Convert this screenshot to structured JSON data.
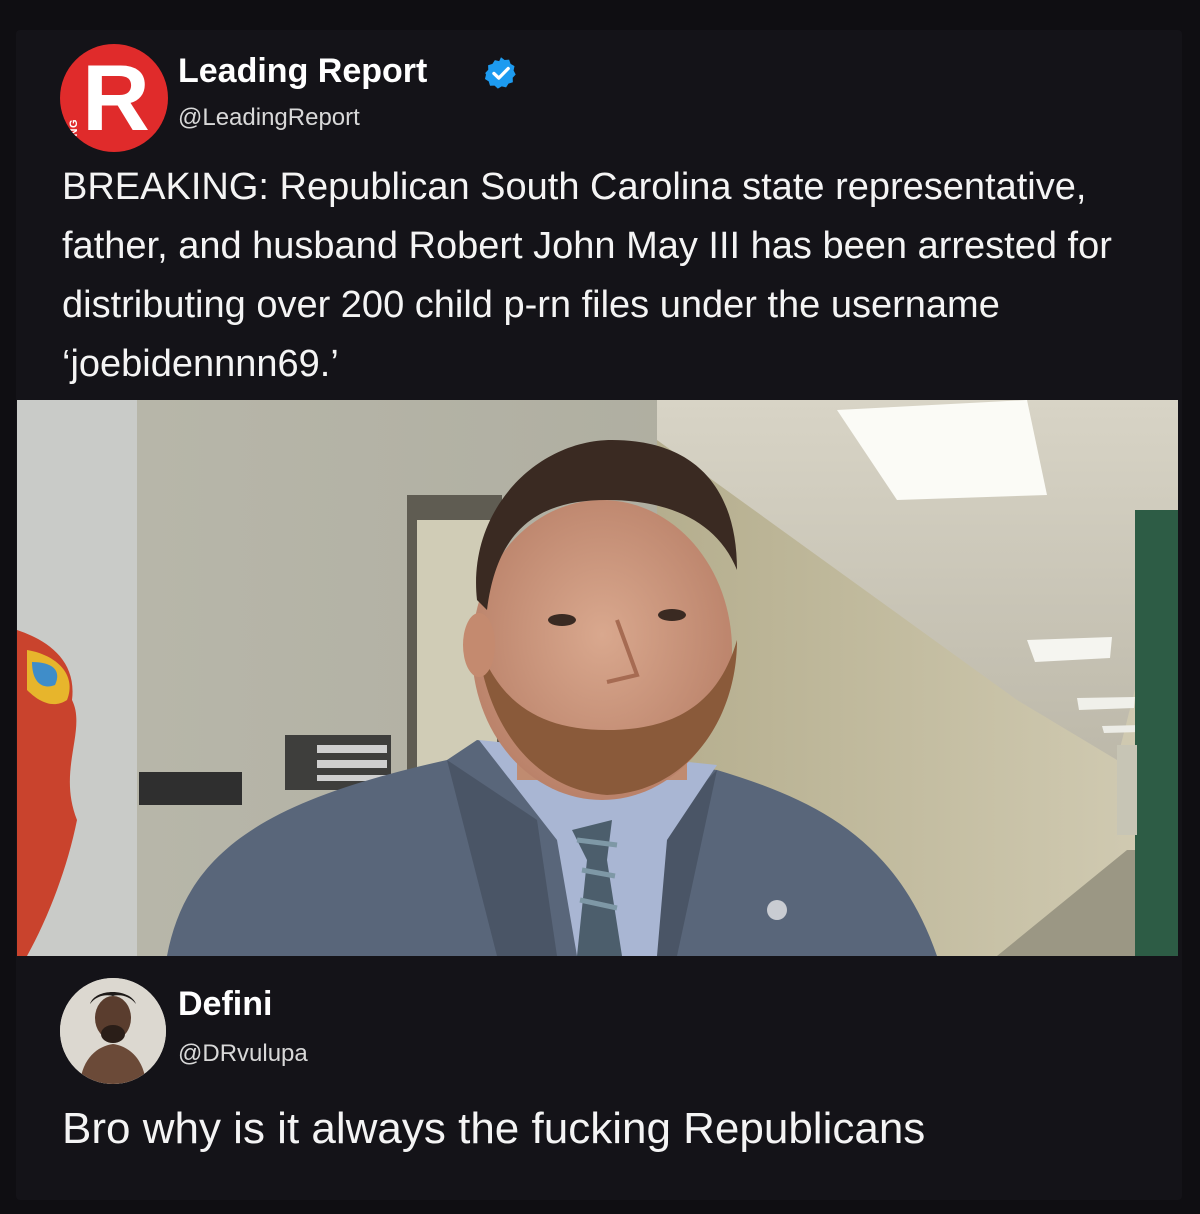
{
  "tweet": {
    "avatar_letter": "R",
    "avatar_side_text": "LEADING",
    "display_name": "Leading Report",
    "handle": "@LeadingReport",
    "verified": true,
    "text": "BREAKING: Republican South Carolina state representative, father, and husband Robert John May III has been arrested for distributing over 200 child p-rn files under the username ‘joebidennnn69.’",
    "colors": {
      "avatar_bg": "#e02b2b",
      "verified_badge": "#1d9bf0"
    }
  },
  "reply": {
    "display_name": "Defini",
    "handle": "@DRvulupa",
    "text": "Bro why is it always the fucking Republicans"
  }
}
